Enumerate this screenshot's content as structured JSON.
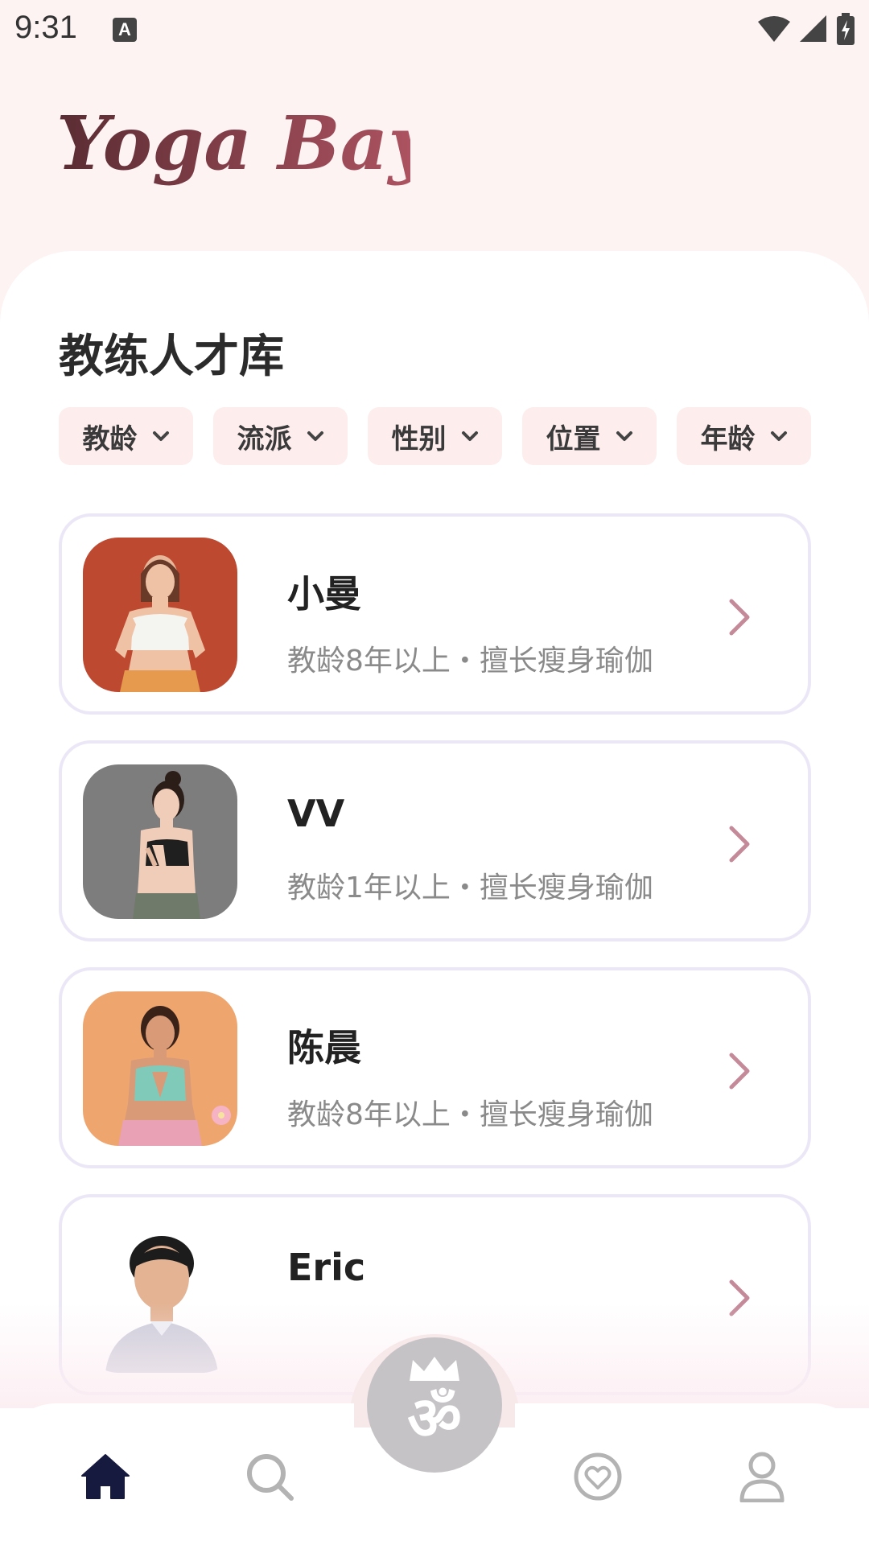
{
  "status_bar": {
    "time": "9:31",
    "notification_icon": "A",
    "icons": [
      "wifi-icon",
      "signal-icon",
      "battery-charging-icon"
    ]
  },
  "app": {
    "logo_text": "Yoga Bay",
    "brand_color": "#8f3d49"
  },
  "main": {
    "title": "教练人才库",
    "filters": [
      {
        "label": "教龄"
      },
      {
        "label": "流派"
      },
      {
        "label": "性别"
      },
      {
        "label": "位置"
      },
      {
        "label": "年龄"
      }
    ],
    "coaches": [
      {
        "name": "小曼",
        "description": "教龄8年以上・擅长瘦身瑜伽"
      },
      {
        "name": "VV",
        "description": "教龄1年以上・擅长瘦身瑜伽"
      },
      {
        "name": "陈晨",
        "description": "教龄8年以上・擅长瘦身瑜伽"
      },
      {
        "name": "Eric",
        "description": ""
      }
    ]
  },
  "bottom_nav": {
    "items": [
      "home-icon",
      "search-icon",
      "om-icon",
      "heart-icon",
      "profile-icon"
    ],
    "center_symbol": "ॐ",
    "active": "home",
    "active_color": "#171a3f",
    "inactive_color": "#b3b3b3"
  },
  "colors": {
    "background": "#fdf3f3",
    "chip_bg": "#fdeded",
    "card_border": "#ece7f6",
    "arrow": "#c48a9a"
  }
}
